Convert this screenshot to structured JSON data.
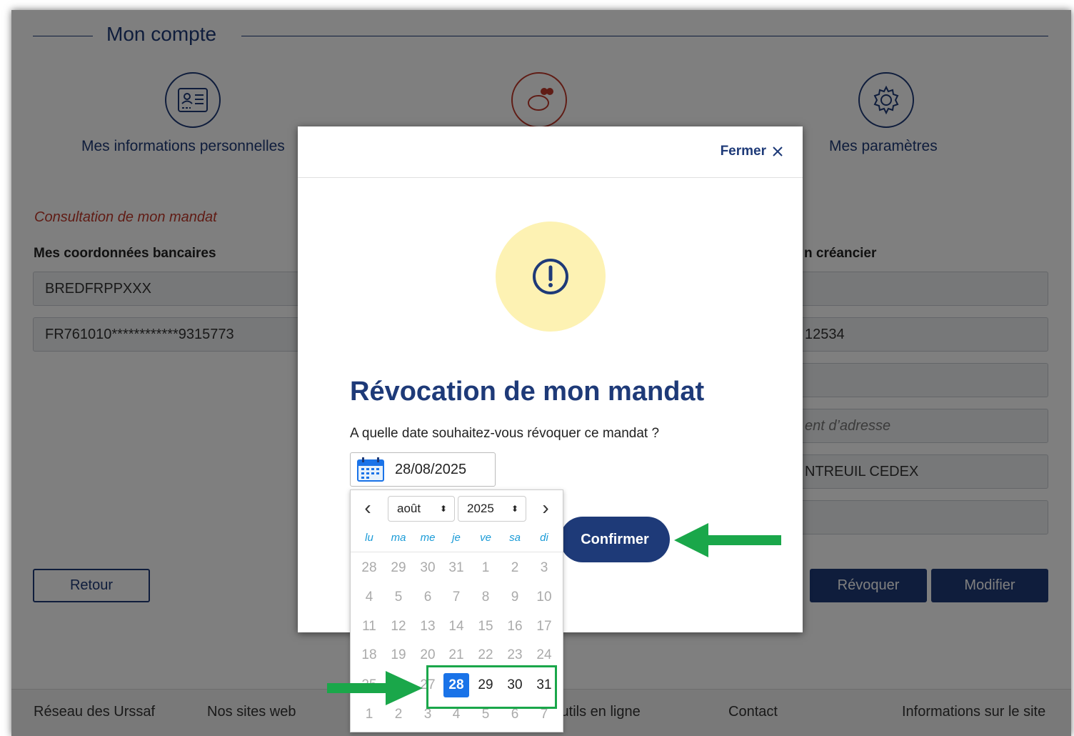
{
  "page": {
    "title": "Mon compte",
    "nav": [
      {
        "label": "Mes informations personnelles",
        "icon": "id-card-icon"
      },
      {
        "label": "",
        "icon": "piggy-bank-icon"
      },
      {
        "label": "Mes paramètres",
        "icon": "gear-icon"
      }
    ],
    "section_label": "Consultation de mon mandat",
    "bank_heading": "Mes coordonnées bancaires",
    "creditor_heading": "n créancier",
    "bic": "BREDFRPPXXX",
    "iban": "FR761010************9315773",
    "right_fields": [
      "",
      "12534",
      "",
      "ent d’adresse",
      "NTREUIL CEDEX",
      ""
    ],
    "buttons": {
      "back": "Retour",
      "revoke": "Révoquer",
      "edit": "Modifier"
    },
    "footer": [
      "Réseau des Urssaf",
      "Nos sites web",
      "Outils en ligne",
      "Contact",
      "Informations sur le site"
    ]
  },
  "modal": {
    "close_label": "Fermer",
    "close_icon": "close-icon",
    "warning_icon": "exclamation-circle-icon",
    "title": "Révocation de mon mandat",
    "question": "A quelle date souhaitez-vous révoquer ce mandat ?",
    "date_value": "28/08/2025",
    "confirm_label": "Confirmer"
  },
  "calendar": {
    "month": "août",
    "year": "2025",
    "weekdays": [
      "lu",
      "ma",
      "me",
      "je",
      "ve",
      "sa",
      "di"
    ],
    "weeks": [
      [
        "28",
        "29",
        "30",
        "31",
        "1",
        "2",
        "3"
      ],
      [
        "4",
        "5",
        "6",
        "7",
        "8",
        "9",
        "10"
      ],
      [
        "11",
        "12",
        "13",
        "14",
        "15",
        "16",
        "17"
      ],
      [
        "18",
        "19",
        "20",
        "21",
        "22",
        "23",
        "24"
      ],
      [
        "25",
        "26",
        "27",
        "28",
        "29",
        "30",
        "31"
      ],
      [
        "1",
        "2",
        "3",
        "4",
        "5",
        "6",
        "7"
      ]
    ],
    "selected": "28",
    "enabled_days": [
      "28",
      "29",
      "30",
      "31"
    ]
  },
  "colors": {
    "brand": "#1e3a78",
    "accent_red": "#c0392b",
    "selected": "#1a73e8",
    "annotation_green": "#1aa74a"
  }
}
